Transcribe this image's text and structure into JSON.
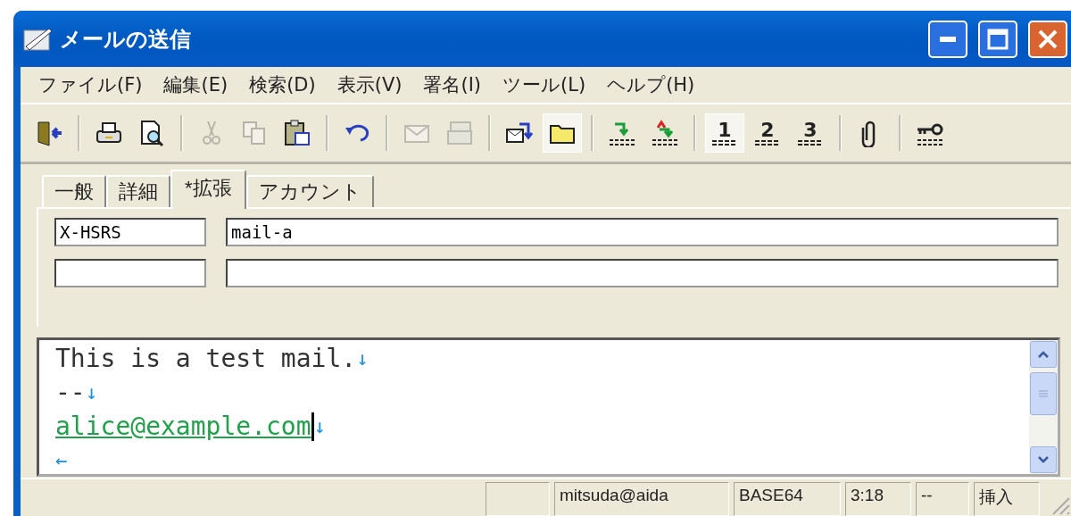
{
  "window": {
    "title": "メールの送信"
  },
  "menu": [
    "ファイル(F)",
    "編集(E)",
    "検索(D)",
    "表示(V)",
    "署名(I)",
    "ツール(L)",
    "ヘルプ(H)"
  ],
  "toolbar": [
    {
      "kind": "button",
      "disabled": false,
      "pressed": false
    },
    {
      "kind": "separator"
    },
    {
      "kind": "button",
      "disabled": false,
      "pressed": false
    },
    {
      "kind": "button",
      "disabled": false,
      "pressed": false
    },
    {
      "kind": "separator"
    },
    {
      "kind": "button",
      "disabled": true,
      "pressed": false
    },
    {
      "kind": "button",
      "disabled": true,
      "pressed": false
    },
    {
      "kind": "button",
      "disabled": false,
      "pressed": false
    },
    {
      "kind": "separator"
    },
    {
      "kind": "button",
      "disabled": false,
      "pressed": false
    },
    {
      "kind": "separator"
    },
    {
      "kind": "button",
      "disabled": true,
      "pressed": false
    },
    {
      "kind": "button",
      "disabled": true,
      "pressed": false
    },
    {
      "kind": "separator"
    },
    {
      "kind": "button",
      "disabled": false,
      "pressed": false
    },
    {
      "kind": "button",
      "disabled": false,
      "pressed": true
    },
    {
      "kind": "separator"
    },
    {
      "kind": "button",
      "disabled": false,
      "pressed": false
    },
    {
      "kind": "button",
      "disabled": false,
      "pressed": false
    },
    {
      "kind": "separator"
    },
    {
      "kind": "number",
      "label": "1",
      "pressed": true
    },
    {
      "kind": "number",
      "label": "2",
      "pressed": false
    },
    {
      "kind": "number",
      "label": "3",
      "pressed": false
    },
    {
      "kind": "separator"
    },
    {
      "kind": "button",
      "disabled": false,
      "pressed": false
    },
    {
      "kind": "separator"
    },
    {
      "kind": "button",
      "disabled": false,
      "pressed": false
    }
  ],
  "tabs": [
    {
      "label": "一般",
      "selected": false
    },
    {
      "label": "詳細",
      "selected": false
    },
    {
      "label": "*拡張",
      "selected": true
    },
    {
      "label": "アカウント",
      "selected": false
    }
  ],
  "headers": [
    {
      "name": "X-HSRS",
      "value": "mail-a"
    }
  ],
  "editor": {
    "lines": [
      {
        "kind": "text",
        "text": "This is a test mail.",
        "end": "↓",
        "caret": false
      },
      {
        "kind": "text",
        "text": "--",
        "end": "↓",
        "caret": false
      },
      {
        "kind": "link",
        "text": "alice@example.com",
        "end": "↓",
        "caret": true
      },
      {
        "kind": "eof",
        "end": "←",
        "caret": false
      }
    ]
  },
  "status_bar": {
    "cells": [
      "mitsuda@aida",
      "BASE64",
      "3:18",
      "--",
      "挿入"
    ]
  }
}
